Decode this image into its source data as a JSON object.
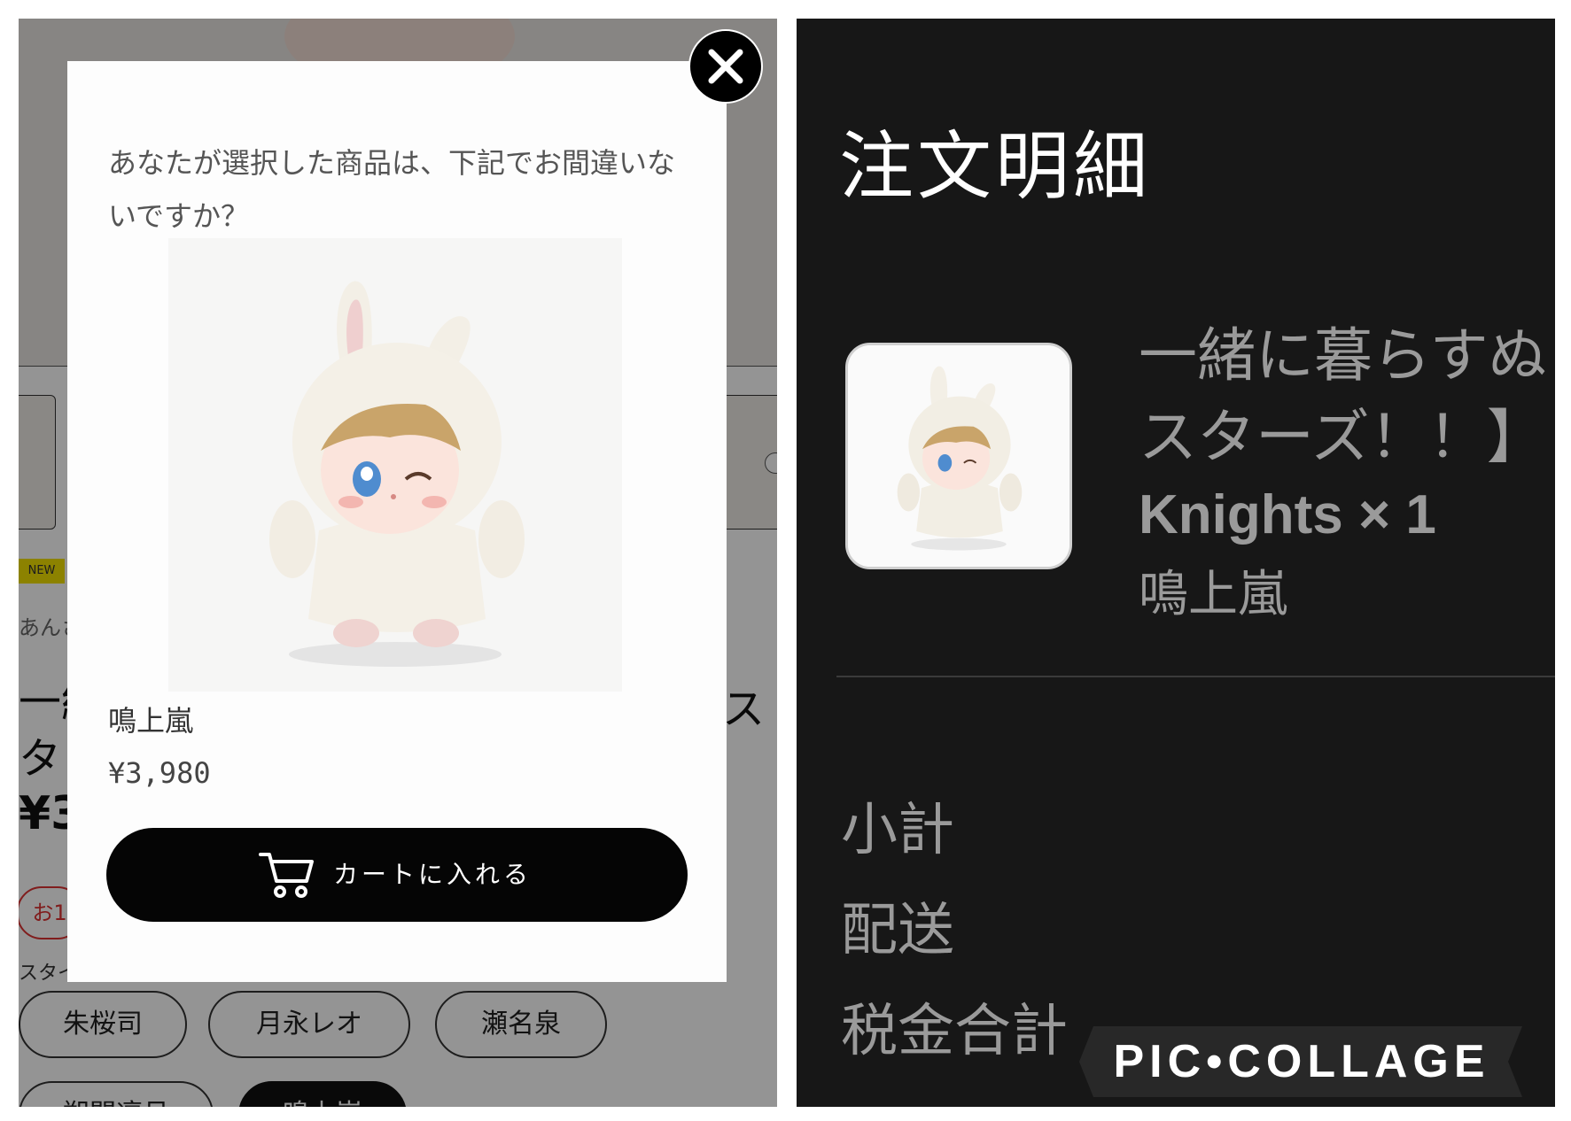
{
  "left": {
    "background": {
      "new_badge": "NEW",
      "brand": "あんさ",
      "title_lines": [
        "一緒",
        "タ・"
      ],
      "title_right": "ス",
      "price": "¥3",
      "sale_badge": "お1",
      "style_label": "スタイ",
      "styles": [
        "朱桜司",
        "月永レオ",
        "瀬名泉",
        "朔間凛月",
        "鳴上嵐"
      ],
      "selected_style": "鳴上嵐"
    },
    "modal": {
      "question": "あなたが選択した商品は、下記でお間違いないですか？",
      "product_name": "鳴上嵐",
      "price": "¥3,980",
      "cart_button": "カートに入れる",
      "cart_icon": "cart-icon",
      "close_icon": "close-icon"
    }
  },
  "right": {
    "title": "注文明細",
    "item": {
      "title_lines": [
        "一緒に暮らすぬ",
        "スターズ！！】"
      ],
      "variant": "Knights × 1",
      "option": "鳴上嵐"
    },
    "summary": [
      "小計",
      "配送",
      "税金合計"
    ]
  },
  "watermark": "PIC•COLLAGE"
}
